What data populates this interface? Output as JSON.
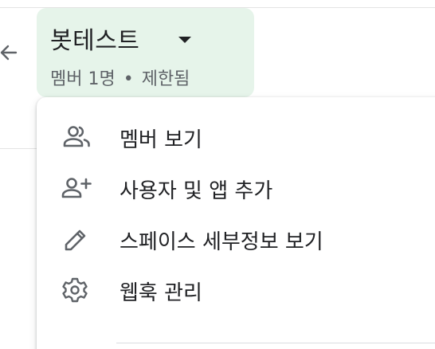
{
  "header": {
    "title": "봇테스트",
    "subtitle_members": "멤버 1명",
    "subtitle_sep": "•",
    "subtitle_status": "제한됨",
    "chip_color": "#e6f4ea"
  },
  "menu": {
    "items": [
      {
        "label": "멤버 보기",
        "icon": "people-icon"
      },
      {
        "label": "사용자 및 앱 추가",
        "icon": "person-add-icon"
      },
      {
        "label": "스페이스 세부정보 보기",
        "icon": "pencil-icon"
      },
      {
        "label": "웹훅 관리",
        "icon": "gear-icon"
      }
    ]
  },
  "colors": {
    "text_primary": "#202124",
    "text_secondary": "#5f6368",
    "icon": "#5f6368"
  }
}
